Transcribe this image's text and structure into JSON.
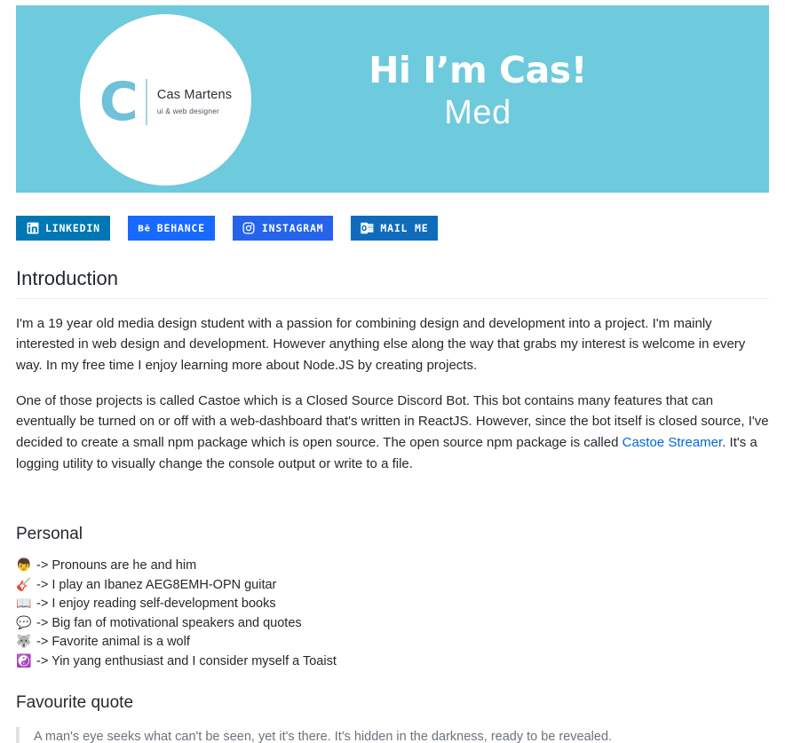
{
  "banner": {
    "bg_color": "#6ecadd",
    "logo": {
      "mark": "C",
      "name": "Cas Martens",
      "role": "ui & web designer"
    },
    "headline": "Hi I’m Cas!",
    "subhead": "Med"
  },
  "badges": [
    {
      "icon": "linkedin-icon",
      "label": "LINKEDIN",
      "color": "#0077b5"
    },
    {
      "icon": "behance-icon",
      "label": "BEHANCE",
      "color": "#1769ff"
    },
    {
      "icon": "instagram-icon",
      "label": "INSTAGRAM",
      "color": "#2563eb"
    },
    {
      "icon": "outlook-icon",
      "label": "MAIL ME",
      "color": "#0f6cbd"
    }
  ],
  "introduction": {
    "heading": "Introduction",
    "paragraph1": "I'm a 19 year old media design student with a passion for combining design and development into a project. I'm mainly interested in web design and development. However anything else along the way that grabs my interest is welcome in every way. In my free time I enjoy learning more about Node.JS by creating projects.",
    "paragraph2_part1": "One of those projects is called Castoe which is a Closed Source Discord Bot. This bot contains many features that can eventually be turned on or off with a web-dashboard that's written in ReactJS. However, since the bot itself is closed source, I've decided to create a small npm package which is open source. The open source npm package is called ",
    "link_text": "Castoe Streamer",
    "link_color": "#0366d6",
    "paragraph2_part2": ". It's a logging utility to visually change the console output or write to a file."
  },
  "personal": {
    "heading": "Personal",
    "items": [
      {
        "emoji": "👦",
        "emoji_name": "boy-emoji",
        "text": "-> Pronouns are he and him"
      },
      {
        "emoji": "🎸",
        "emoji_name": "guitar-emoji",
        "text": "-> I play an Ibanez AEG8EMH-OPN guitar"
      },
      {
        "emoji": "📖",
        "emoji_name": "open-book-emoji",
        "text": "-> I enjoy reading self-development books"
      },
      {
        "emoji": "💬",
        "emoji_name": "speech-balloon-emoji",
        "text": "-> Big fan of motivational speakers and quotes"
      },
      {
        "emoji": "🐺",
        "emoji_name": "wolf-emoji",
        "text": "-> Favorite animal is a wolf"
      },
      {
        "emoji": "☯️",
        "emoji_name": "yin-yang-emoji",
        "text": "-> Yin yang enthusiast and I consider myself a Toaist"
      }
    ]
  },
  "quote": {
    "heading": "Favourite quote",
    "text": "A man's eye seeks what can't be seen, yet it's there. It's hidden in the darkness, ready to be revealed."
  }
}
